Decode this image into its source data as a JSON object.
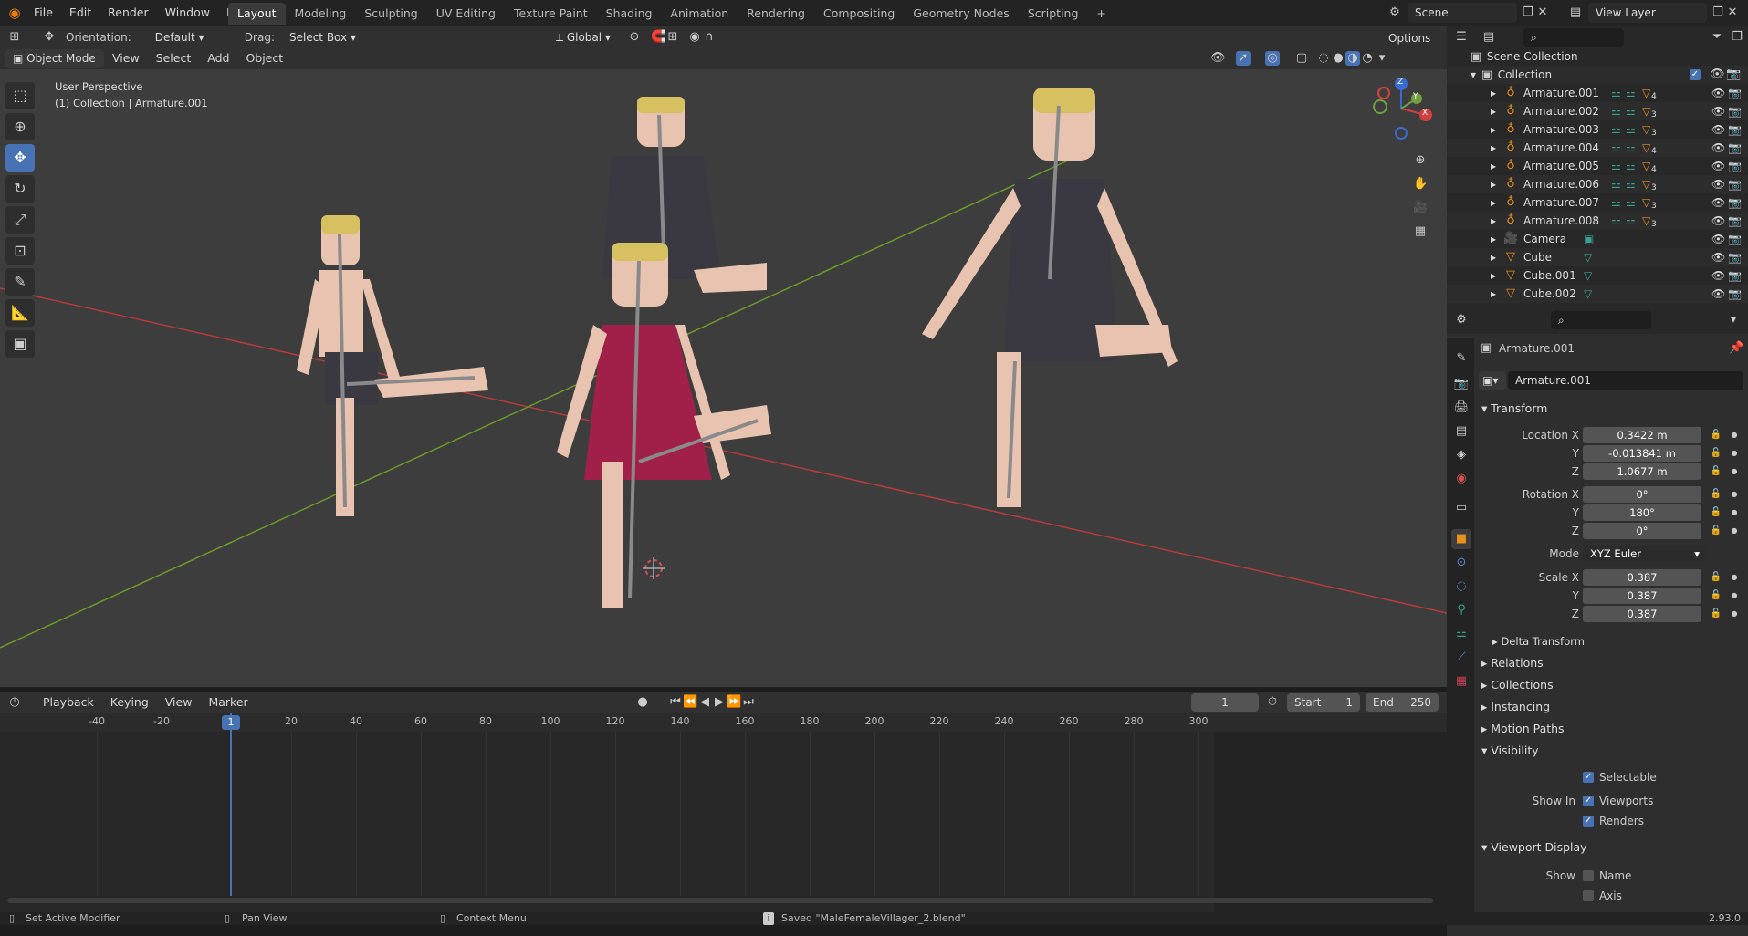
{
  "topbar": {
    "menus": [
      "File",
      "Edit",
      "Render",
      "Window",
      "Help"
    ],
    "workspaces": [
      "Layout",
      "Modeling",
      "Sculpting",
      "UV Editing",
      "Texture Paint",
      "Shading",
      "Animation",
      "Rendering",
      "Compositing",
      "Geometry Nodes",
      "Scripting"
    ],
    "active_workspace": "Layout",
    "add_tab": "+",
    "scene": "Scene",
    "view_layer": "View Layer"
  },
  "viewport_header": {
    "orientation_label": "Orientation:",
    "orientation_value": "Default",
    "drag_label": "Drag:",
    "drag_value": "Select Box",
    "transform_orientation": "Global",
    "options": "Options",
    "mode": "Object Mode",
    "menus": [
      "View",
      "Select",
      "Add",
      "Object"
    ]
  },
  "viewport": {
    "perspective": "User Perspective",
    "collection_info": "(1) Collection | Armature.001",
    "gizmo": {
      "z": "Z",
      "y": "Y",
      "x": "X"
    },
    "colors": {
      "background": "#3d3d3d",
      "x_axis": "#b53a3a",
      "y_axis": "#6a9a2a",
      "skin": "#e8c4b0",
      "hair": "#d6c060",
      "dark_cloth": "#3a3840",
      "red_cloth": "#a0204a",
      "bone": "#8a8a8a"
    }
  },
  "outliner": {
    "scene_collection": "Scene Collection",
    "collection": "Collection",
    "items": [
      {
        "name": "Armature.001",
        "type": "armature",
        "extra": "4"
      },
      {
        "name": "Armature.002",
        "type": "armature",
        "extra": "3"
      },
      {
        "name": "Armature.003",
        "type": "armature",
        "extra": "3"
      },
      {
        "name": "Armature.004",
        "type": "armature",
        "extra": "4"
      },
      {
        "name": "Armature.005",
        "type": "armature",
        "extra": "4"
      },
      {
        "name": "Armature.006",
        "type": "armature",
        "extra": "3"
      },
      {
        "name": "Armature.007",
        "type": "armature",
        "extra": "3"
      },
      {
        "name": "Armature.008",
        "type": "armature",
        "extra": "3"
      },
      {
        "name": "Camera",
        "type": "camera",
        "extra": ""
      },
      {
        "name": "Cube",
        "type": "mesh",
        "extra": ""
      },
      {
        "name": "Cube.001",
        "type": "mesh",
        "extra": ""
      },
      {
        "name": "Cube.002",
        "type": "mesh",
        "extra": ""
      }
    ]
  },
  "properties": {
    "object_name": "Armature.001",
    "object_field": "Armature.001",
    "transform_title": "Transform",
    "location_label": "Location X",
    "location": {
      "x": "0.3422 m",
      "y": "-0.013841 m",
      "z": "1.0677 m"
    },
    "rotation_label": "Rotation X",
    "rotation": {
      "x": "0°",
      "y": "180°",
      "z": "0°"
    },
    "mode_label": "Mode",
    "mode_value": "XYZ Euler",
    "scale_label": "Scale X",
    "scale": {
      "x": "0.387",
      "y": "0.387",
      "z": "0.387"
    },
    "axis_y": "Y",
    "axis_z": "Z",
    "delta_transform": "Delta Transform",
    "sections": [
      "Relations",
      "Collections",
      "Instancing",
      "Motion Paths"
    ],
    "visibility_title": "Visibility",
    "selectable": "Selectable",
    "show_in": "Show In",
    "viewports": "Viewports",
    "renders": "Renders",
    "viewport_display": "Viewport Display",
    "show": "Show",
    "name_label": "Name",
    "axis_label": "Axis"
  },
  "timeline": {
    "menus": [
      "Playback",
      "Keying",
      "View",
      "Marker"
    ],
    "current_frame": "1",
    "start_label": "Start",
    "start": "1",
    "end_label": "End",
    "end": "250",
    "ticks": [
      "-40",
      "-20",
      "1",
      "20",
      "40",
      "60",
      "80",
      "100",
      "120",
      "140",
      "160",
      "180",
      "200",
      "220",
      "240",
      "260",
      "280",
      "300"
    ]
  },
  "statusbar": {
    "left1": "Set Active Modifier",
    "left2": "Pan View",
    "left3": "Context Menu",
    "message": "Saved \"MaleFemaleVillager_2.blend\"",
    "version": "2.93.0"
  }
}
